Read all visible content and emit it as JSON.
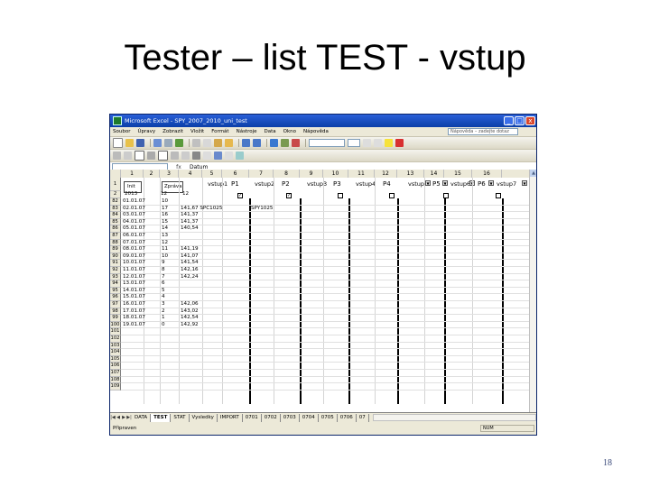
{
  "slide": {
    "title": "Tester – list TEST - vstup",
    "page_number": "18"
  },
  "window": {
    "title": "Microsoft Excel - SPY_2007_2010_uni_test",
    "buttons": {
      "minimize": "_",
      "maximize": "□",
      "close": "x"
    }
  },
  "menu": {
    "items": [
      "Soubor",
      "Úpravy",
      "Zobrazit",
      "Vložit",
      "Formát",
      "Nástroje",
      "Data",
      "Okno",
      "Nápověda"
    ],
    "help_placeholder": "Nápověda – zadejte dotaz"
  },
  "formula_bar": {
    "fx": "fx",
    "value": "Datum"
  },
  "columns": [
    "1",
    "2",
    "3",
    "4",
    "5",
    "6",
    "7",
    "8",
    "9",
    "10",
    "11",
    "12",
    "13",
    "14",
    "15",
    "16"
  ],
  "header_labels": {
    "a": "Init",
    "b": "Zpráva",
    "c": "vstup1",
    "d": "P1",
    "e": "vstup2",
    "f": "P2",
    "g": "vstup3",
    "h": "P3",
    "i": "vstup4",
    "j": "P4",
    "k": "vstup5",
    "l": "P5",
    "m": "vstup6",
    "n": "P6",
    "o": "vstup7"
  },
  "row2": {
    "a": "2013",
    "b": "12",
    "c": "12"
  },
  "rows": [
    {
      "num": "82",
      "date": "01.01.07",
      "n": "10",
      "v": ""
    },
    {
      "num": "83",
      "date": "02.01.07",
      "n": "17",
      "v": "141,67 SPC1025",
      "p": "SPY1025"
    },
    {
      "num": "84",
      "date": "03.01.07",
      "n": "16",
      "v": "141,37"
    },
    {
      "num": "85",
      "date": "04.01.07",
      "n": "15",
      "v": "141,37"
    },
    {
      "num": "86",
      "date": "05.01.07",
      "n": "14",
      "v": "140,54"
    },
    {
      "num": "87",
      "date": "06.01.07",
      "n": "13",
      "v": ""
    },
    {
      "num": "88",
      "date": "07.01.07",
      "n": "12",
      "v": ""
    },
    {
      "num": "89",
      "date": "08.01.07",
      "n": "11",
      "v": "141,19"
    },
    {
      "num": "90",
      "date": "09.01.07",
      "n": "10",
      "v": "141,07"
    },
    {
      "num": "91",
      "date": "10.01.07",
      "n": "9",
      "v": "141,54"
    },
    {
      "num": "92",
      "date": "11.01.07",
      "n": "8",
      "v": "142,16"
    },
    {
      "num": "93",
      "date": "12.01.07",
      "n": "7",
      "v": "142,24"
    },
    {
      "num": "94",
      "date": "13.01.07",
      "n": "6",
      "v": ""
    },
    {
      "num": "95",
      "date": "14.01.07",
      "n": "5",
      "v": ""
    },
    {
      "num": "96",
      "date": "15.01.07",
      "n": "4",
      "v": ""
    },
    {
      "num": "97",
      "date": "16.01.07",
      "n": "3",
      "v": "142,06"
    },
    {
      "num": "98",
      "date": "17.01.07",
      "n": "2",
      "v": "143,02"
    },
    {
      "num": "99",
      "date": "18.01.07",
      "n": "1",
      "v": "142,54"
    },
    {
      "num": "100",
      "date": "19.01.07",
      "n": "0",
      "v": "142,92"
    },
    {
      "num": "101",
      "date": "",
      "n": "",
      "v": ""
    },
    {
      "num": "102",
      "date": "",
      "n": "",
      "v": ""
    },
    {
      "num": "103",
      "date": "",
      "n": "",
      "v": ""
    },
    {
      "num": "104",
      "date": "",
      "n": "",
      "v": ""
    },
    {
      "num": "105",
      "date": "",
      "n": "",
      "v": ""
    },
    {
      "num": "106",
      "date": "",
      "n": "",
      "v": ""
    },
    {
      "num": "107",
      "date": "",
      "n": "",
      "v": ""
    },
    {
      "num": "108",
      "date": "",
      "n": "",
      "v": ""
    },
    {
      "num": "109",
      "date": "",
      "n": "",
      "v": ""
    }
  ],
  "sheet_tabs": [
    "DATA",
    "TEST",
    "STAT",
    "Vysledky",
    "IMPORT",
    "0701",
    "0702",
    "0703",
    "0704",
    "0705",
    "0706",
    "07"
  ],
  "active_tab": "TEST",
  "status": {
    "left": "Připraven",
    "right": "NUM"
  }
}
